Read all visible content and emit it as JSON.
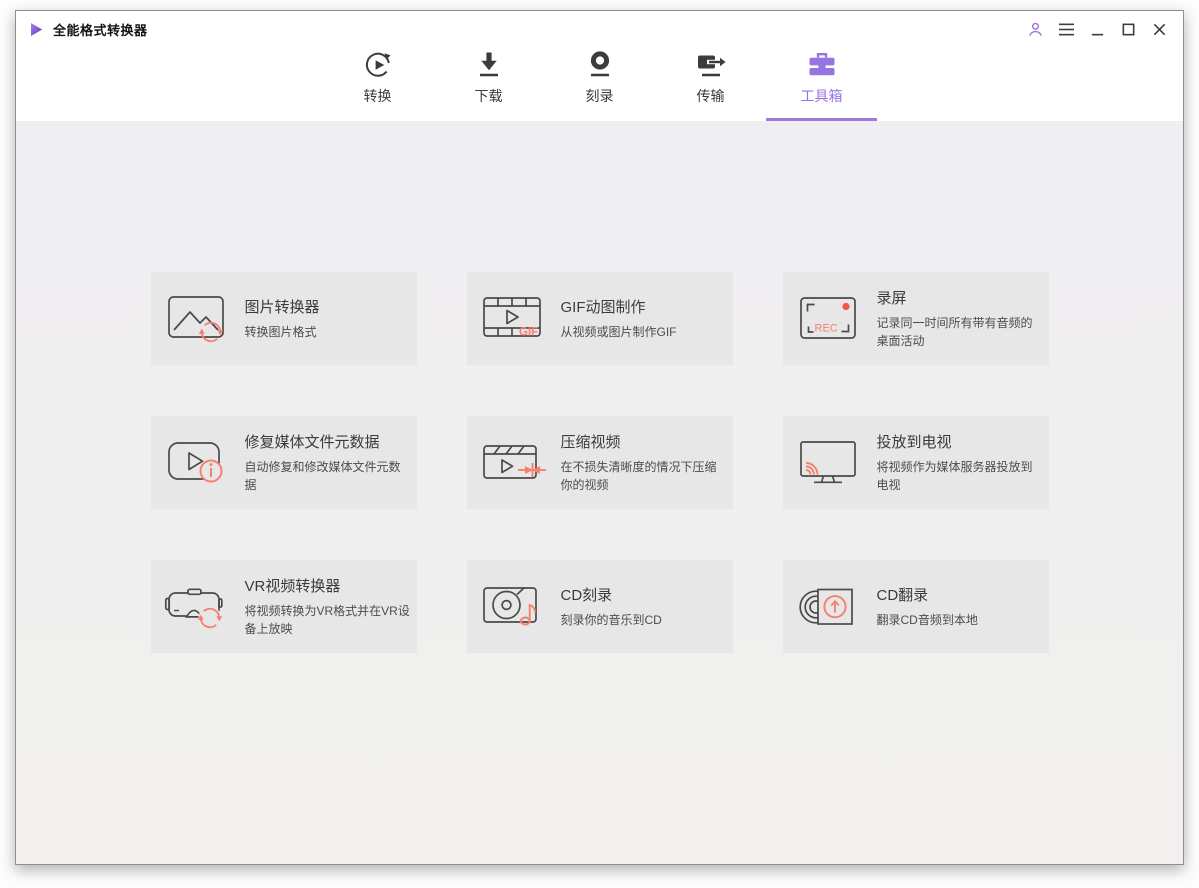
{
  "app": {
    "title": "全能格式转换器"
  },
  "colors": {
    "accent": "#9674e2",
    "accent_underline": "#9d7ce2",
    "coral": "#f5806e",
    "record_red": "#f0564a",
    "card_bg": "#e8e7e7",
    "icon_stroke": "#4a4a4a"
  },
  "titlebar": {
    "controls": [
      {
        "id": "account",
        "icon": "account-icon"
      },
      {
        "id": "menu",
        "icon": "menu-icon"
      },
      {
        "id": "minimize",
        "icon": "minimize-icon"
      },
      {
        "id": "maximize",
        "icon": "maximize-icon"
      },
      {
        "id": "close",
        "icon": "close-icon"
      }
    ]
  },
  "nav": {
    "tabs": [
      {
        "id": "convert",
        "label": "转换",
        "icon": "convert-icon",
        "active": false
      },
      {
        "id": "download",
        "label": "下载",
        "icon": "download-icon",
        "active": false
      },
      {
        "id": "burn",
        "label": "刻录",
        "icon": "burn-icon",
        "active": false
      },
      {
        "id": "transfer",
        "label": "传输",
        "icon": "transfer-icon",
        "active": false
      },
      {
        "id": "toolbox",
        "label": "工具箱",
        "icon": "toolbox-icon",
        "active": true
      }
    ]
  },
  "toolbox": {
    "cards": [
      {
        "id": "image-converter",
        "title": "图片转换器",
        "description": "转换图片格式",
        "icon": "image-converter-icon"
      },
      {
        "id": "gif-maker",
        "title": "GIF动图制作",
        "description": "从视频或图片制作GIF",
        "icon": "gif-maker-icon"
      },
      {
        "id": "screen-recorder",
        "title": "录屏",
        "description": "记录同一时间所有带有音频的桌面活动",
        "icon": "screen-recorder-icon"
      },
      {
        "id": "fix-metadata",
        "title": "修复媒体文件元数据",
        "description": "自动修复和修改媒体文件元数据",
        "icon": "fix-metadata-icon"
      },
      {
        "id": "video-compressor",
        "title": "压缩视频",
        "description": "在不损失清晰度的情况下压缩你的视频",
        "icon": "compress-video-icon"
      },
      {
        "id": "cast-to-tv",
        "title": "投放到电视",
        "description": "将视频作为媒体服务器投放到电视",
        "icon": "cast-to-tv-icon"
      },
      {
        "id": "vr-converter",
        "title": "VR视频转换器",
        "description": "将视频转换为VR格式并在VR设备上放映",
        "icon": "vr-converter-icon"
      },
      {
        "id": "cd-burner",
        "title": "CD刻录",
        "description": "刻录你的音乐到CD",
        "icon": "cd-burn-icon"
      },
      {
        "id": "cd-ripper",
        "title": "CD翻录",
        "description": "翻录CD音频到本地",
        "icon": "cd-rip-icon"
      }
    ]
  }
}
